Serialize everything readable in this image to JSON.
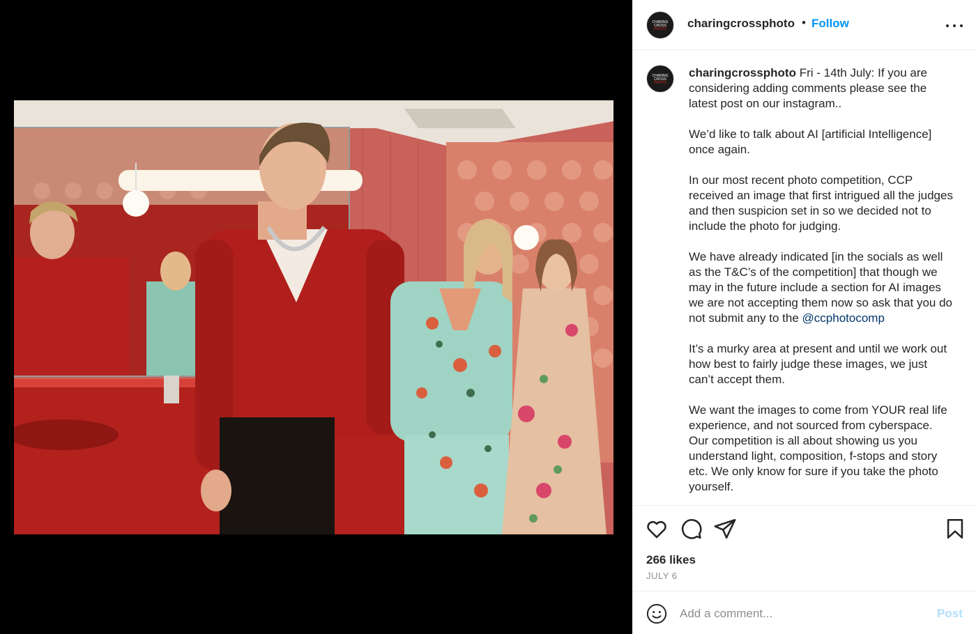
{
  "header": {
    "username": "charingcrossphoto",
    "separator": "•",
    "follow_label": "Follow",
    "more_icon": "more-horizontal-icon"
  },
  "avatar": {
    "line1": "CHARING",
    "line2": "CROSS",
    "line3": "PHOTO"
  },
  "caption": {
    "username": "charingcrossphoto",
    "p1": "Fri - 14th July: If you are considering adding comments please see the latest post on our instagram..",
    "p2": "We’d like to talk about AI [artificial Intelligence] once again.",
    "p3": "In our most recent photo competition, CCP received an image that first intrigued all the judges and then suspicion set in so we decided not to include the photo for judging.",
    "p4_text": "We have already indicated [in the socials as well as the T&C’s of the competition] that though we may in the future include a section for AI images we are not accepting them now so ask that you do not submit any to the ",
    "p4_mention": "@ccphotocomp",
    "p5": "It’s a murky area at present and until we work out how best to fairly judge these images, we just can’t accept them.",
    "p6": "We want the images to come from YOUR real life experience, and not sourced from cyberspace. Our competition is all about showing us you understand light, composition, f-stops and story etc. We only know for sure if you take the photo yourself."
  },
  "actions": {
    "like_icon": "heart-icon",
    "comment_icon": "comment-icon",
    "share_icon": "share-icon",
    "save_icon": "bookmark-icon"
  },
  "likes": "266 likes",
  "date": "JULY 6",
  "comment": {
    "placeholder": "Add a comment...",
    "post_label": "Post",
    "emoji_icon": "emoji-icon"
  },
  "colors": {
    "link_blue": "#0095f6",
    "post_disabled": "#b3dffc",
    "mention": "#00376b"
  }
}
